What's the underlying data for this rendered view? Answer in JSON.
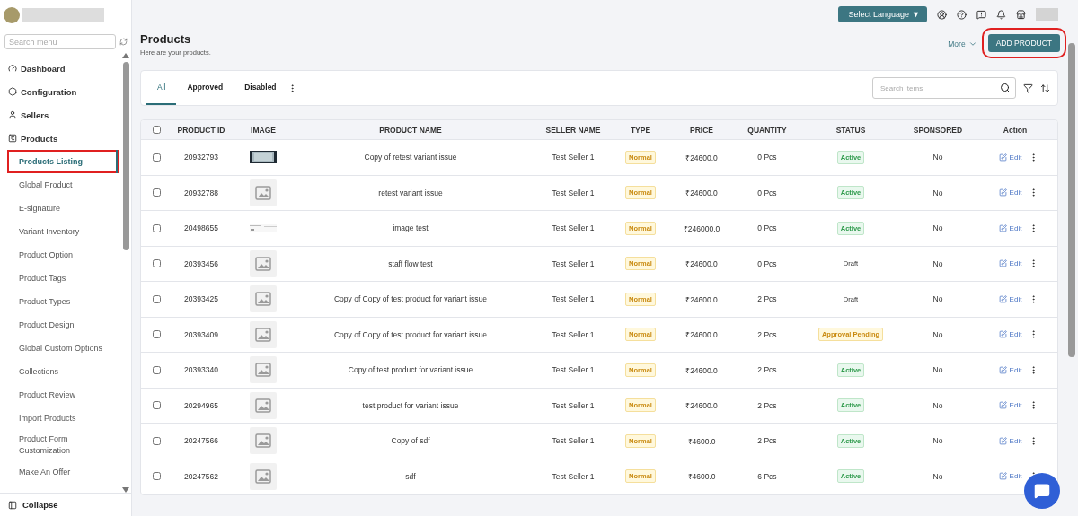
{
  "sidebar": {
    "search": {
      "placeholder": "Search menu"
    },
    "items": [
      {
        "label": "Dashboard"
      },
      {
        "label": "Configuration"
      },
      {
        "label": "Sellers"
      },
      {
        "label": "Products",
        "children": [
          {
            "label": "Products Listing",
            "selected": true
          },
          {
            "label": "Global Product",
            "selected": false
          },
          {
            "label": "E-signature",
            "selected": false
          },
          {
            "label": "Variant Inventory",
            "selected": false
          },
          {
            "label": "Product Option",
            "selected": false
          },
          {
            "label": "Product Tags",
            "selected": false
          },
          {
            "label": "Product Types",
            "selected": false
          },
          {
            "label": "Product Design",
            "selected": false
          },
          {
            "label": "Global Custom Options",
            "selected": false
          },
          {
            "label": "Collections",
            "selected": false
          },
          {
            "label": "Product Review",
            "selected": false
          },
          {
            "label": "Import Products",
            "selected": false
          },
          {
            "label": "Product Form Customization",
            "selected": false
          },
          {
            "label": "Make An Offer",
            "selected": false
          }
        ]
      }
    ],
    "collapse": "Collapse"
  },
  "topbar": {
    "language": "Select Language",
    "language_caret": "▼"
  },
  "header": {
    "title": "Products",
    "subtitle": "Here are your products.",
    "more": "More",
    "add_button": "ADD PRODUCT"
  },
  "tabs": [
    {
      "label": "All",
      "selected": true
    },
    {
      "label": "Approved",
      "selected": false
    },
    {
      "label": "Disabled",
      "selected": false
    }
  ],
  "search": {
    "placeholder": "Search Items"
  },
  "table": {
    "select_all": {
      "checked": false
    },
    "columns": [
      "PRODUCT ID",
      "IMAGE",
      "PRODUCT NAME",
      "SELLER NAME",
      "TYPE",
      "PRICE",
      "QUANTITY",
      "STATUS",
      "SPONSORED",
      "Action"
    ],
    "rows": [
      {
        "checked": false,
        "id": "20932793",
        "name": "Copy of retest variant issue",
        "seller": "Test Seller 1",
        "type": "Normal",
        "price": "₹24600.0",
        "quantity": "0 Pcs",
        "status": {
          "text": "Active",
          "kind": "active"
        },
        "sponsored": "No",
        "edit": "Edit"
      },
      {
        "checked": false,
        "id": "20932788",
        "image": {
          "kind": "placeholder"
        },
        "name": "retest variant issue",
        "seller": "Test Seller 1",
        "type": "Normal",
        "price": "₹24600.0",
        "quantity": "0 Pcs",
        "status": {
          "text": "Active",
          "kind": "active"
        },
        "sponsored": "No",
        "edit": "Edit"
      },
      {
        "checked": false,
        "id": "20498655",
        "name": "image test",
        "seller": "Test Seller 1",
        "type": "Normal",
        "price": "₹246000.0",
        "quantity": "0 Pcs",
        "status": {
          "text": "Active",
          "kind": "active"
        },
        "sponsored": "No",
        "edit": "Edit"
      },
      {
        "checked": false,
        "id": "20393456",
        "image": {
          "kind": "placeholder"
        },
        "name": "staff flow test",
        "seller": "Test Seller 1",
        "type": "Normal",
        "price": "₹24600.0",
        "quantity": "0 Pcs",
        "status": {
          "text": "Draft",
          "kind": "plain"
        },
        "sponsored": "No",
        "edit": "Edit"
      },
      {
        "checked": false,
        "id": "20393425",
        "image": {
          "kind": "placeholder"
        },
        "name": "Copy of Copy of test product for variant issue",
        "seller": "Test Seller 1",
        "type": "Normal",
        "price": "₹24600.0",
        "quantity": "2 Pcs",
        "status": {
          "text": "Draft",
          "kind": "plain"
        },
        "sponsored": "No",
        "edit": "Edit"
      },
      {
        "checked": false,
        "id": "20393409",
        "image": {
          "kind": "placeholder"
        },
        "name": "Copy of Copy of test product for variant issue",
        "seller": "Test Seller 1",
        "type": "Normal",
        "price": "₹24600.0",
        "quantity": "2 Pcs",
        "status": {
          "text": "Approval Pending",
          "kind": "warning"
        },
        "sponsored": "No",
        "edit": "Edit"
      },
      {
        "checked": false,
        "id": "20393340",
        "image": {
          "kind": "placeholder"
        },
        "name": "Copy of test product for variant issue",
        "seller": "Test Seller 1",
        "type": "Normal",
        "price": "₹24600.0",
        "quantity": "2 Pcs",
        "status": {
          "text": "Active",
          "kind": "active"
        },
        "sponsored": "No",
        "edit": "Edit"
      },
      {
        "checked": false,
        "id": "20294965",
        "image": {
          "kind": "placeholder"
        },
        "name": "test product for variant issue",
        "seller": "Test Seller 1",
        "type": "Normal",
        "price": "₹24600.0",
        "quantity": "2 Pcs",
        "status": {
          "text": "Active",
          "kind": "active"
        },
        "sponsored": "No",
        "edit": "Edit"
      },
      {
        "checked": false,
        "id": "20247566",
        "image": {
          "kind": "placeholder"
        },
        "name": "Copy of sdf",
        "seller": "Test Seller 1",
        "type": "Normal",
        "price": "₹4600.0",
        "quantity": "2 Pcs",
        "status": {
          "text": "Active",
          "kind": "active"
        },
        "sponsored": "No",
        "edit": "Edit"
      },
      {
        "checked": false,
        "id": "20247562",
        "image": {
          "kind": "placeholder"
        },
        "name": "sdf",
        "seller": "Test Seller 1",
        "type": "Normal",
        "price": "₹4600.0",
        "quantity": "6 Pcs",
        "status": {
          "text": "Active",
          "kind": "active"
        },
        "sponsored": "No",
        "edit": "Edit"
      }
    ]
  }
}
